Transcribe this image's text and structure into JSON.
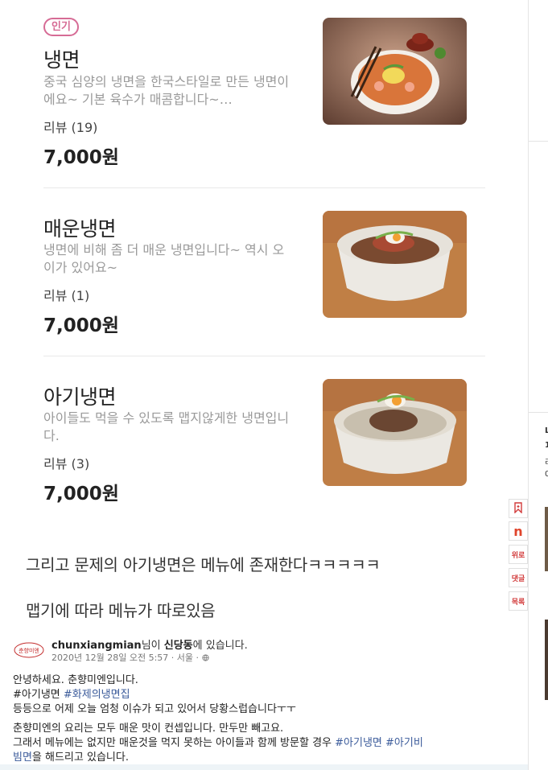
{
  "menu": [
    {
      "badge": "인기",
      "name": "냉면",
      "desc": "중국 심양의 냉면을 한국스타일로 만든 냉면이에요~ 기본 육수가 매콤합니다~…",
      "review": "리뷰 (19)",
      "price": "7,000원"
    },
    {
      "name": "매운냉면",
      "desc": "냉면에 비해 좀 더 매운 냉면입니다~ 역시 오이가 있어요~",
      "review": "리뷰 (1)",
      "price": "7,000원"
    },
    {
      "name": "아기냉면",
      "desc": "아이들도 먹을 수 있도록 맵지않게한 냉면입니다.",
      "review": "리뷰 (3)",
      "price": "7,000원"
    }
  ],
  "commentary": {
    "line1": "그리고 문제의 아기냉면은 메뉴에 존재한다ㅋㅋㅋㅋㅋ",
    "line2": "맵기에 따라 메뉴가 따로있음"
  },
  "post": {
    "author": "chunxiangmian",
    "author_suffix": "님이 ",
    "place": "신당동",
    "place_suffix": "에 있습니다.",
    "meta": "2020년 12월 28일 오전 5:57 · 서울 ·",
    "line1": "안녕하세요. 춘향미엔입니다.",
    "line2_tag1": "#아기냉면",
    "line2_tag2": "#화제의냉면집",
    "line3": "등등으로 어제 오늘 엄청 이슈가 되고 있어서 당황스럽습니다ㅜㅜ",
    "line4": "춘향미엔의 요리는 모두 매운 맛이 컨셉입니다. 만두만 빼고요.",
    "line5_pre": "그래서 메뉴에는 없지만 매운것을 먹지 못하는 아이들과 함께 방문할 경우 ",
    "line5_tag1": "#아기냉면",
    "line5_tag2": "#아기비",
    "line6_tag": "빔면",
    "line6_post": "을 해드리고 있습니다."
  },
  "side_buttons": {
    "bookmark_icon": "bookmark-icon",
    "naver_logo": "n",
    "top": "위로",
    "comments": "댓글",
    "list": "목록"
  },
  "right_fragments": [
    "L",
    "1",
    "리",
    "0"
  ],
  "colors": {
    "badge": "#d66b95",
    "tag": "#3a5a9a",
    "side_button_text": "#d23b3b"
  }
}
